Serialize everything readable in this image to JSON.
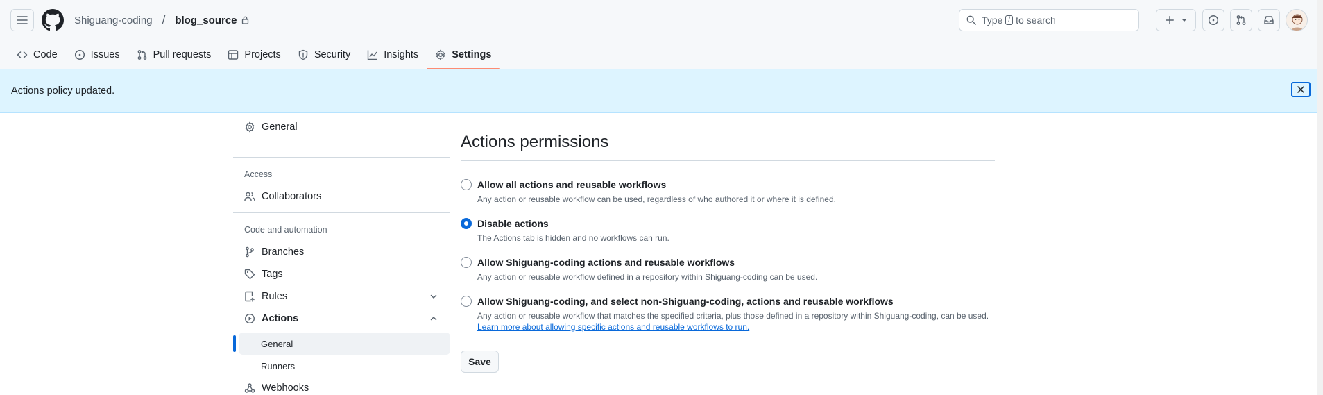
{
  "header": {
    "owner": "Shiguang-coding",
    "separator": "/",
    "repo": "blog_source",
    "search_prefix": "Type",
    "search_key": "/",
    "search_suffix": "to search"
  },
  "nav": {
    "tabs": [
      {
        "label": "Code",
        "icon": "code-icon"
      },
      {
        "label": "Issues",
        "icon": "issue-opened-icon"
      },
      {
        "label": "Pull requests",
        "icon": "git-pull-request-icon"
      },
      {
        "label": "Projects",
        "icon": "table-icon"
      },
      {
        "label": "Security",
        "icon": "shield-icon"
      },
      {
        "label": "Insights",
        "icon": "graph-icon"
      },
      {
        "label": "Settings",
        "icon": "gear-icon",
        "active": true
      }
    ]
  },
  "flash": {
    "message": "Actions policy updated."
  },
  "sidebar": {
    "general": "General",
    "access_heading": "Access",
    "collaborators": "Collaborators",
    "code_heading": "Code and automation",
    "branches": "Branches",
    "tags": "Tags",
    "rules": "Rules",
    "actions": "Actions",
    "actions_general": "General",
    "actions_runners": "Runners",
    "webhooks": "Webhooks"
  },
  "main": {
    "title": "Actions permissions",
    "options": [
      {
        "label": "Allow all actions and reusable workflows",
        "description": "Any action or reusable workflow can be used, regardless of who authored it or where it is defined.",
        "checked": false
      },
      {
        "label": "Disable actions",
        "description": "The Actions tab is hidden and no workflows can run.",
        "checked": true
      },
      {
        "label": "Allow Shiguang-coding actions and reusable workflows",
        "description": "Any action or reusable workflow defined in a repository within Shiguang-coding can be used.",
        "checked": false
      },
      {
        "label": "Allow Shiguang-coding, and select non-Shiguang-coding, actions and reusable workflows",
        "description": "Any action or reusable workflow that matches the specified criteria, plus those defined in a repository within Shiguang-coding, can be used.",
        "link": "Learn more about allowing specific actions and reusable workflows to run.",
        "checked": false
      }
    ],
    "save_label": "Save"
  },
  "colors": {
    "accent": "#0969da",
    "flash_bg": "#ddf4ff",
    "tab_underline": "#fd8c73"
  }
}
